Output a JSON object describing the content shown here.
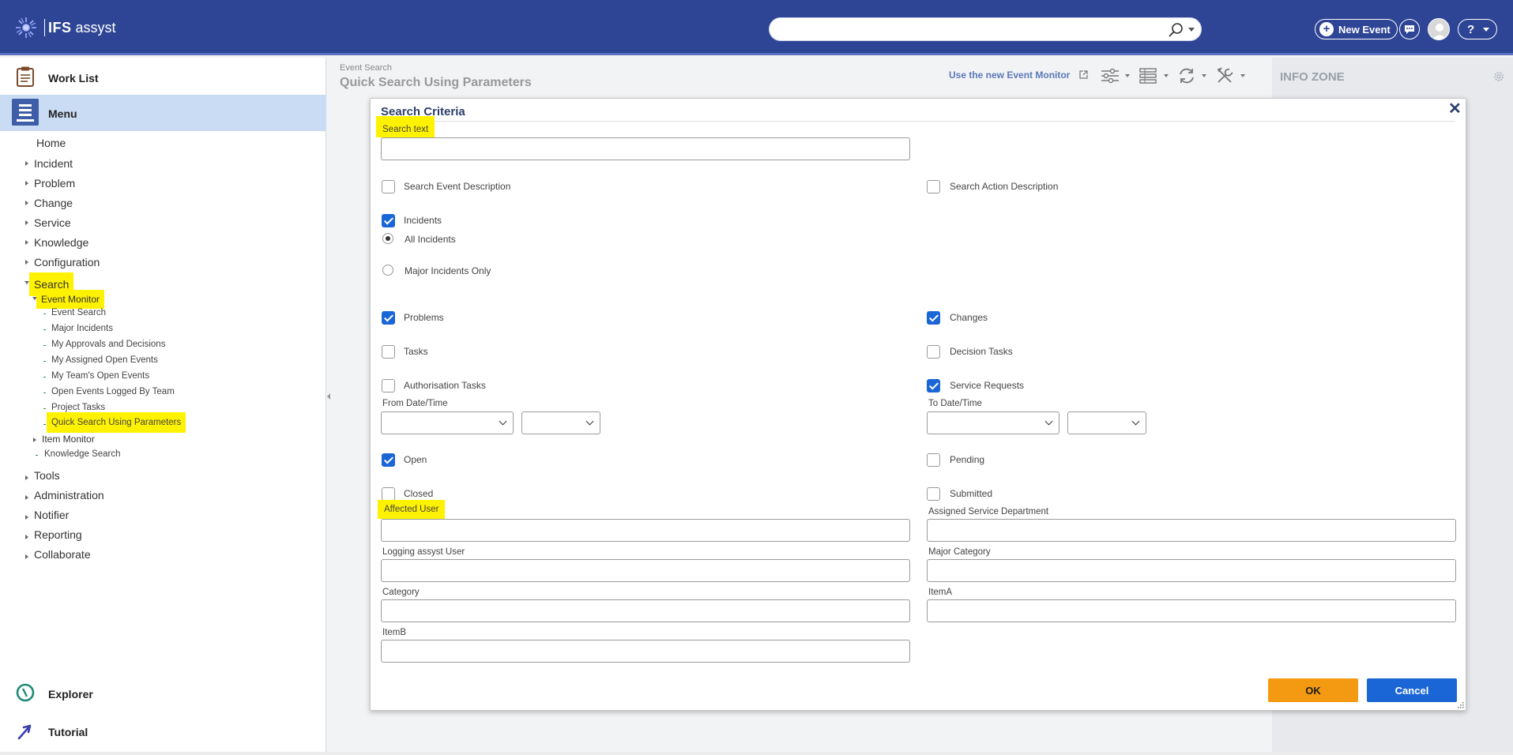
{
  "header": {
    "brand": "IFS",
    "product": "assyst",
    "search_placeholder": "",
    "new_event_label": "New Event",
    "help_label": "?"
  },
  "sidebar": {
    "worklist_label": "Work List",
    "menu_label": "Menu",
    "tree": {
      "home": "Home",
      "incident": "Incident",
      "problem": "Problem",
      "change": "Change",
      "service": "Service",
      "knowledge": "Knowledge",
      "configuration": "Configuration",
      "search": "Search",
      "event_monitor": "Event Monitor",
      "event_search": "Event Search",
      "major_incidents": "Major Incidents",
      "my_approvals": "My Approvals and Decisions",
      "my_assigned": "My Assigned Open Events",
      "my_team": "My Team's Open Events",
      "open_events_team": "Open Events Logged By Team",
      "project_tasks": "Project Tasks",
      "quick_search": "Quick Search Using Parameters",
      "item_monitor": "Item Monitor",
      "knowledge_search": "Knowledge Search",
      "tools": "Tools",
      "administration": "Administration",
      "notifier": "Notifier",
      "reporting": "Reporting",
      "collaborate": "Collaborate"
    },
    "explorer_label": "Explorer",
    "tutorial_label": "Tutorial"
  },
  "content": {
    "breadcrumb": "Event Search",
    "title": "Quick Search Using Parameters",
    "new_monitor_link": "Use the new Event Monitor",
    "info_zone": "INFO ZONE"
  },
  "dialog": {
    "title": "Search Criteria",
    "close": "✕",
    "search_text_label": "Search text",
    "search_text_value": "",
    "checkboxes": {
      "search_event_desc": {
        "label": "Search Event Description",
        "checked": false
      },
      "search_action_desc": {
        "label": "Search Action Description",
        "checked": false
      },
      "incidents": {
        "label": "Incidents",
        "checked": true
      },
      "problems": {
        "label": "Problems",
        "checked": true
      },
      "changes": {
        "label": "Changes",
        "checked": true
      },
      "tasks": {
        "label": "Tasks",
        "checked": false
      },
      "decision_tasks": {
        "label": "Decision Tasks",
        "checked": false
      },
      "authorisation_tasks": {
        "label": "Authorisation Tasks",
        "checked": false
      },
      "service_requests": {
        "label": "Service Requests",
        "checked": true
      },
      "open": {
        "label": "Open",
        "checked": true
      },
      "pending": {
        "label": "Pending",
        "checked": false
      },
      "closed": {
        "label": "Closed",
        "checked": false
      },
      "submitted": {
        "label": "Submitted",
        "checked": false
      }
    },
    "radios": {
      "all_incidents": {
        "label": "All Incidents",
        "selected": true
      },
      "major_only": {
        "label": "Major Incidents Only",
        "selected": false
      }
    },
    "from_date_label": "From Date/Time",
    "to_date_label": "To Date/Time",
    "fields": {
      "affected_user": "Affected User",
      "assigned_dept": "Assigned Service Department",
      "logging_user": "Logging assyst User",
      "major_category": "Major Category",
      "category": "Category",
      "item_a": "ItemA",
      "item_b": "ItemB"
    },
    "ok_label": "OK",
    "cancel_label": "Cancel"
  },
  "colors": {
    "topbar": "#2e4595",
    "highlight": "#fff200",
    "ok": "#f39a12",
    "primary": "#1a66d6"
  }
}
